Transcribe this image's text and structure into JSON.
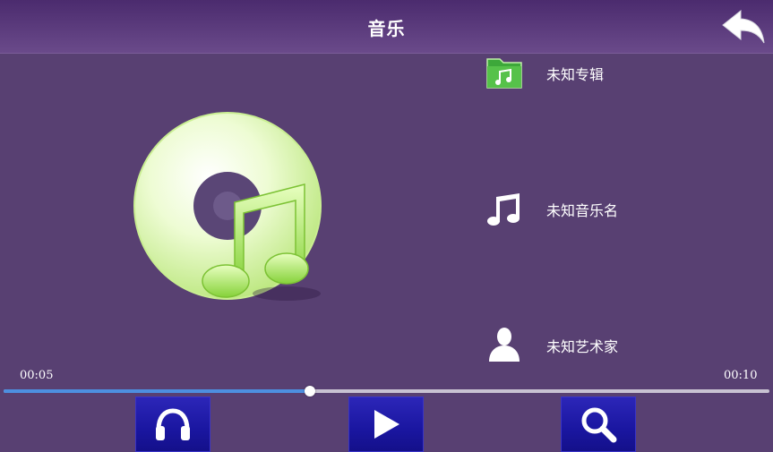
{
  "header": {
    "title": "音乐",
    "back_icon": "back-arrow-icon"
  },
  "artwork": {
    "icon": "music-disc-icon"
  },
  "info": {
    "album": {
      "label": "未知专辑",
      "icon": "album-folder-icon"
    },
    "song": {
      "label": "未知音乐名",
      "icon": "music-note-icon"
    },
    "artist": {
      "label": "未知艺术家",
      "icon": "artist-person-icon"
    }
  },
  "player": {
    "current_time": "00:05",
    "total_time": "00:10",
    "progress": 0.4
  },
  "controls": [
    {
      "name": "headphones-button",
      "icon": "headphones-icon"
    },
    {
      "name": "play-button",
      "icon": "play-icon"
    },
    {
      "name": "search-button",
      "icon": "search-icon"
    }
  ],
  "colors": {
    "background": "#584072",
    "header": "#5a3a7c",
    "progress_fill": "#4d8fe0",
    "button": "#1a16a0",
    "disc": "#d8f5a8",
    "note": "#9ee04a"
  }
}
